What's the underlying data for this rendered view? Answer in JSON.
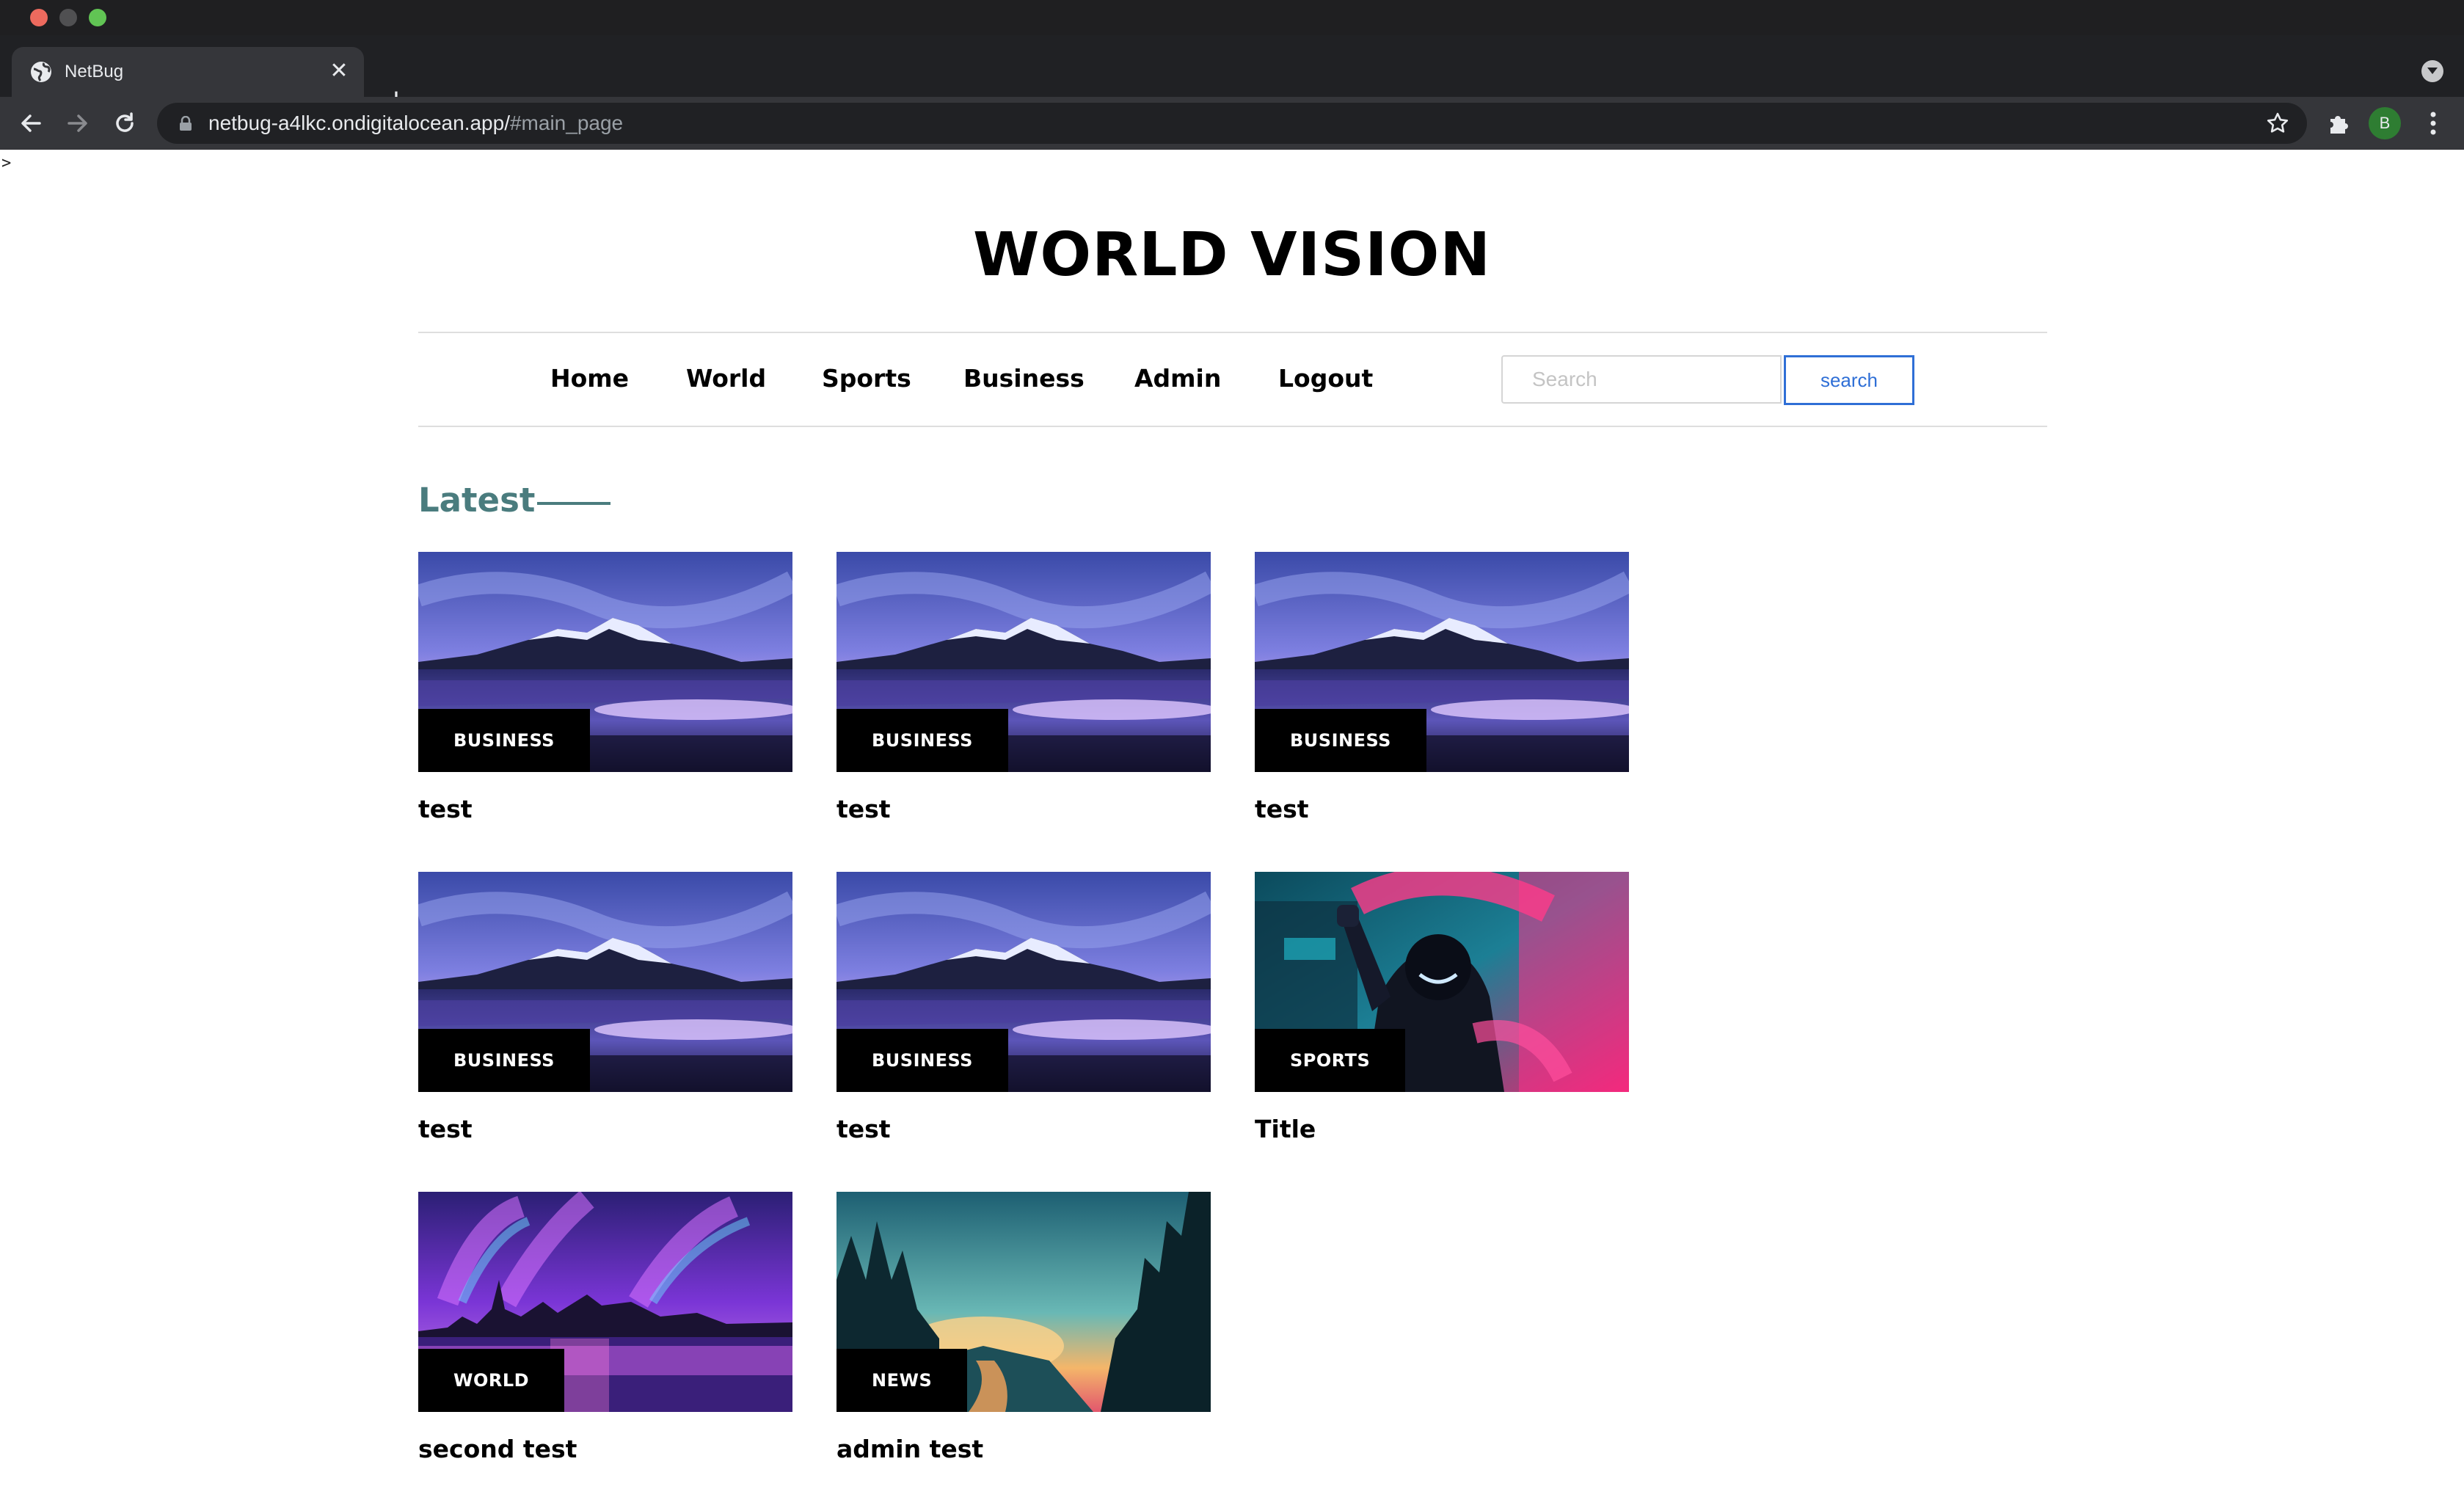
{
  "browser": {
    "tab_title": "NetBug",
    "url_host": "netbug-a4lkc.ondigitalocean.app/",
    "url_path": "#main_page",
    "profile_initial": "B",
    "prompt_glyph": ">"
  },
  "site": {
    "title": "WORLD VISION"
  },
  "nav": {
    "items": [
      {
        "label": "Home"
      },
      {
        "label": "World"
      },
      {
        "label": "Sports"
      },
      {
        "label": "Business"
      },
      {
        "label": "Admin"
      },
      {
        "label": "Logout"
      }
    ]
  },
  "search": {
    "placeholder": "Search",
    "button_label": "search",
    "accent": "#2f6fd6"
  },
  "section": {
    "heading": "Latest",
    "accent": "#4a7c7e"
  },
  "articles": [
    {
      "category": "BUSINESS",
      "title": "test",
      "image": "mountain-lake"
    },
    {
      "category": "BUSINESS",
      "title": "test",
      "image": "mountain-lake"
    },
    {
      "category": "BUSINESS",
      "title": "test",
      "image": "mountain-lake"
    },
    {
      "category": "BUSINESS",
      "title": "test",
      "image": "mountain-lake"
    },
    {
      "category": "BUSINESS",
      "title": "test",
      "image": "mountain-lake"
    },
    {
      "category": "SPORTS",
      "title": "Title",
      "image": "neon-hacker"
    },
    {
      "category": "WORLD",
      "title": "second test",
      "image": "aurora-city"
    },
    {
      "category": "NEWS",
      "title": "admin test",
      "image": "forest-sunset"
    }
  ]
}
